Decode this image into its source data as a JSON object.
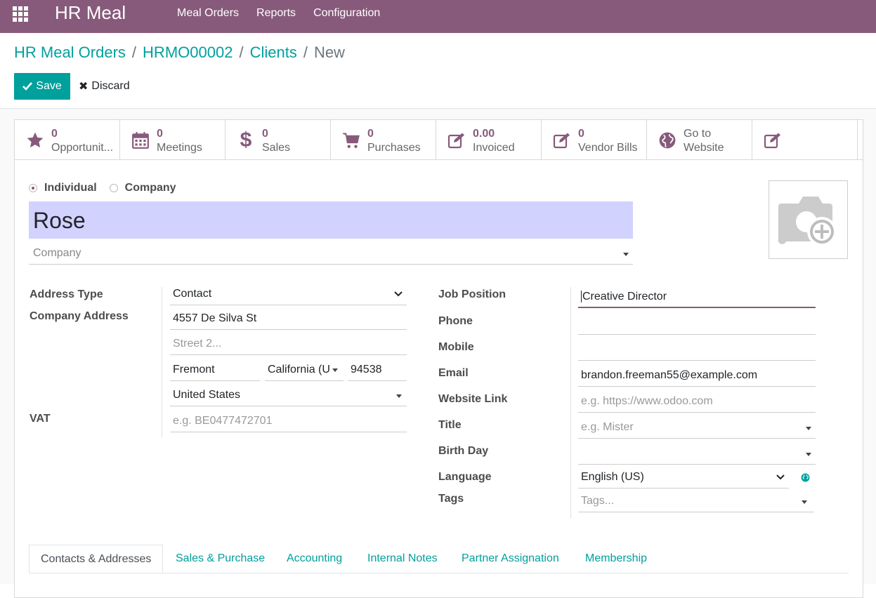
{
  "navbar": {
    "brand": "HR Meal",
    "menu": [
      "Meal Orders",
      "Reports",
      "Configuration"
    ]
  },
  "breadcrumb": {
    "items": [
      "HR Meal Orders",
      "HRMO00002",
      "Clients"
    ],
    "active": "New"
  },
  "actions": {
    "save_label": "Save",
    "discard_label": "Discard"
  },
  "smart_buttons": [
    {
      "icon": "star-icon",
      "value": "0",
      "label": "Opportunit..."
    },
    {
      "icon": "calendar-icon",
      "value": "0",
      "label": "Meetings"
    },
    {
      "icon": "dollar-icon",
      "value": "0",
      "label": "Sales"
    },
    {
      "icon": "cart-icon",
      "value": "0",
      "label": "Purchases"
    },
    {
      "icon": "edit-icon",
      "value": "0.00",
      "label": "Invoiced"
    },
    {
      "icon": "edit-icon",
      "value": "0",
      "label": "Vendor Bills"
    },
    {
      "icon": "globe-icon",
      "label1": "Go to",
      "label2": "Website"
    },
    {
      "icon": "edit-icon"
    }
  ],
  "company_type": {
    "individual": "Individual",
    "company": "Company",
    "selected": "Individual"
  },
  "name": "Rose",
  "company_placeholder": "Company",
  "left_group": {
    "address_type_label": "Address Type",
    "address_type_value": "Contact",
    "company_address_label": "Company Address",
    "street": "4557 De Silva St",
    "street2_placeholder": "Street 2...",
    "city": "Fremont",
    "state": "California (U",
    "zip": "94538",
    "country": "United States",
    "vat_label": "VAT",
    "vat_placeholder": "e.g. BE0477472701"
  },
  "right_group": {
    "job_position_label": "Job Position",
    "job_position_value": "Creative Director",
    "phone_label": "Phone",
    "mobile_label": "Mobile",
    "email_label": "Email",
    "email_value": "brandon.freeman55@example.com",
    "website_label": "Website Link",
    "website_placeholder": "e.g. https://www.odoo.com",
    "title_label": "Title",
    "title_placeholder": "e.g. Mister",
    "birthday_label": "Birth Day",
    "language_label": "Language",
    "language_value": "English (US)",
    "tags_label": "Tags",
    "tags_placeholder": "Tags..."
  },
  "tabs": [
    "Contacts & Addresses",
    "Sales & Purchase",
    "Accounting",
    "Internal Notes",
    "Partner Assignation",
    "Membership"
  ],
  "colors": {
    "primary": "#875a7b",
    "teal": "#00a09d",
    "name_bg": "#d2d2ff"
  }
}
